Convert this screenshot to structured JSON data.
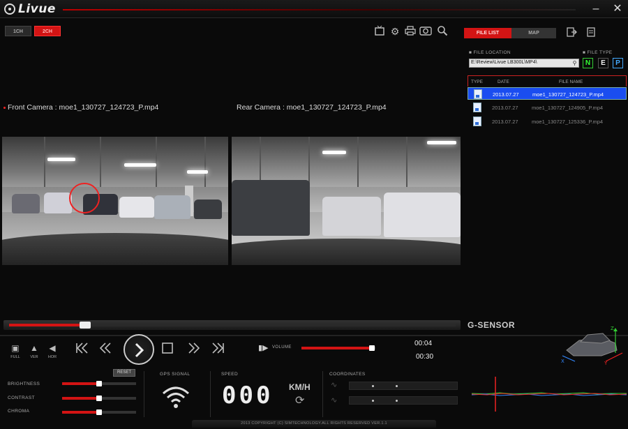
{
  "app": {
    "name": "Livue"
  },
  "channels": [
    {
      "label": "1CH"
    },
    {
      "label": "2CH"
    }
  ],
  "toolbar_icons": [
    "tv-icon",
    "settings-icon",
    "print-icon",
    "snapshot-icon",
    "search-icon"
  ],
  "right_panel": {
    "tabs": [
      {
        "label": "FILE LIST"
      },
      {
        "label": "MAP"
      }
    ],
    "file_location_label": "FILE LOCATION",
    "file_location_value": "E:\\Review\\Livue LB300L\\MP4\\",
    "file_type_label": "FILE TYPE",
    "file_types": [
      "N",
      "E",
      "P"
    ],
    "table_headers": {
      "type": "TYPE",
      "date": "DATE",
      "file_name": "FILE NAME"
    },
    "files": [
      {
        "date": "2013.07.27",
        "name": "moe1_130727_124723_P.mp4",
        "selected": true
      },
      {
        "date": "2013.07.27",
        "name": "moe1_130727_124905_P.mp4",
        "selected": false
      },
      {
        "date": "2013.07.27",
        "name": "moe1_130727_125336_P.mp4",
        "selected": false
      }
    ]
  },
  "cameras": {
    "front_label": "Front Camera : moe1_130727_124723_P.mp4",
    "rear_label": "Rear Camera : moe1_130727_124723_P.mp4"
  },
  "playback": {
    "progress": 0.17,
    "volume_label": "VOLUME",
    "volume": 0.97,
    "time_current": "00:04",
    "time_total": "00:30"
  },
  "view_modes": [
    {
      "label": "FULL"
    },
    {
      "label": "VER"
    },
    {
      "label": "HOR"
    }
  ],
  "gsensor": {
    "title": "G-SENSOR",
    "axes": [
      "X",
      "Y",
      "Z"
    ]
  },
  "adjustments": {
    "reset_label": "RESET",
    "items": [
      {
        "label": "BRIGHTNESS",
        "value": 0.5
      },
      {
        "label": "CONTRAST",
        "value": 0.5
      },
      {
        "label": "CHROMA",
        "value": 0.5
      }
    ]
  },
  "gps": {
    "label": "GPS SIGNAL"
  },
  "speed": {
    "label": "SPEED",
    "value": "000",
    "unit": "KM/H"
  },
  "coordinates": {
    "label": "COORDINATES"
  },
  "footer": {
    "copyright": "2013 COPYRIGHT (C) SIMTECHNOLOGY.ALL RIGHTS RESERVED VER.1.1"
  },
  "colors": {
    "accent": "#d31414",
    "selected_row": "#1a4df0"
  }
}
